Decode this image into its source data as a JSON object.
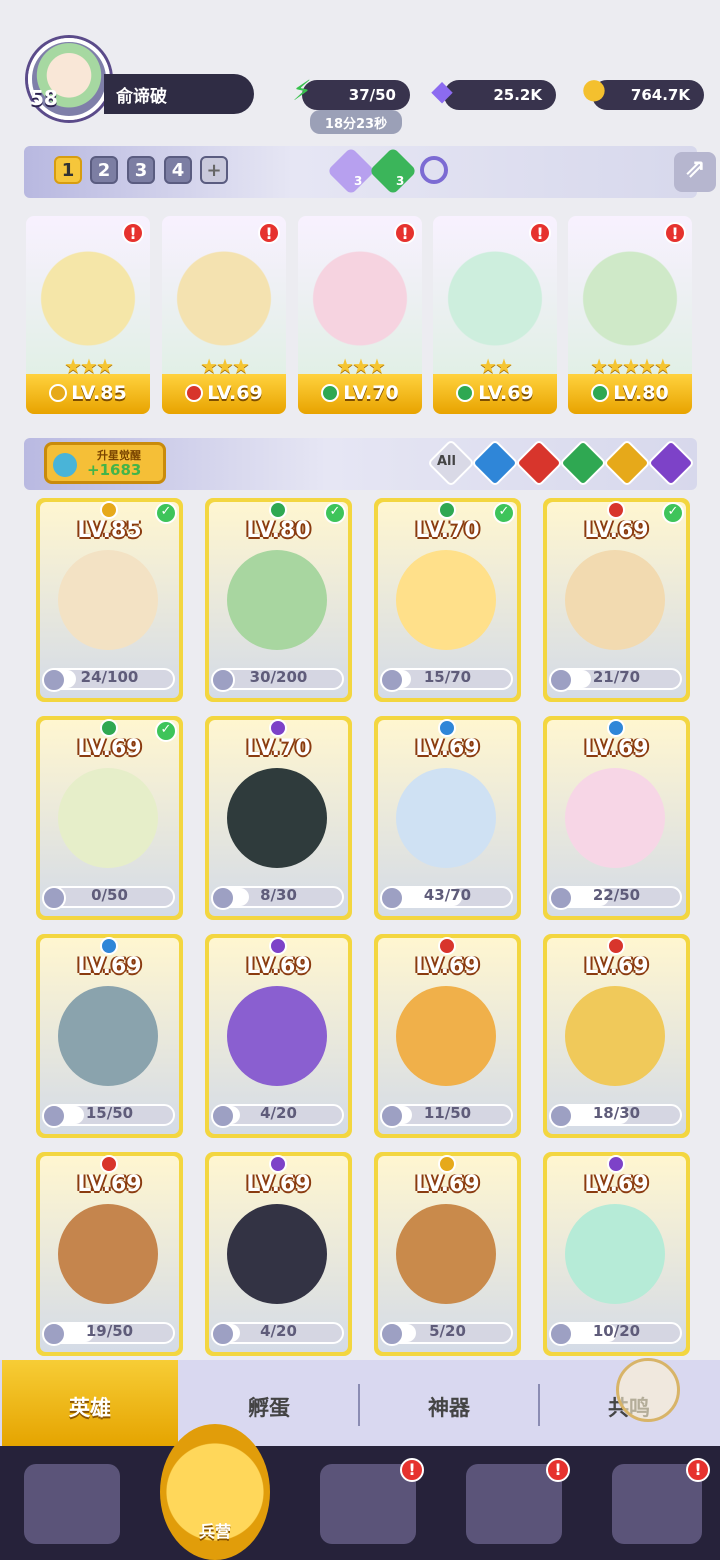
{
  "profile": {
    "level": "58",
    "name": "俞谛破"
  },
  "resources": {
    "energy": {
      "value": "37/50",
      "timer": "18分23秒"
    },
    "diamonds": {
      "value": "25.2K"
    },
    "coins": {
      "value": "764.7K"
    }
  },
  "teams": {
    "slots": [
      "1",
      "2",
      "3",
      "4"
    ],
    "add": "+",
    "gem1": "3",
    "gem2": "3"
  },
  "team_cards": [
    {
      "lv": "LV.85",
      "element": "light",
      "stars": "★★★"
    },
    {
      "lv": "LV.69",
      "element": "fire",
      "stars": "★★★"
    },
    {
      "lv": "LV.70",
      "element": "wind",
      "stars": "★★★"
    },
    {
      "lv": "LV.69",
      "element": "wind",
      "stars": "★★"
    },
    {
      "lv": "LV.80",
      "element": "wind",
      "stars": "★★★★★"
    }
  ],
  "upgrade": {
    "title": "升星觉醒",
    "count": "+1683"
  },
  "filters": {
    "all": "All"
  },
  "heroes": [
    {
      "lv": "LV.85",
      "el": "light",
      "prog": "24/100",
      "check": true
    },
    {
      "lv": "LV.80",
      "el": "wind",
      "prog": "30/200",
      "check": true
    },
    {
      "lv": "LV.70",
      "el": "wind",
      "prog": "15/70",
      "check": true
    },
    {
      "lv": "LV.69",
      "el": "fire",
      "prog": "21/70",
      "check": true
    },
    {
      "lv": "LV.69",
      "el": "wind",
      "prog": "0/50",
      "check": true
    },
    {
      "lv": "LV.70",
      "el": "dark",
      "prog": "8/30",
      "check": false
    },
    {
      "lv": "LV.69",
      "el": "water",
      "prog": "43/70",
      "check": false
    },
    {
      "lv": "LV.69",
      "el": "water",
      "prog": "22/50",
      "check": false
    },
    {
      "lv": "LV.69",
      "el": "water",
      "prog": "15/50",
      "check": false
    },
    {
      "lv": "LV.69",
      "el": "dark",
      "prog": "4/20",
      "check": false
    },
    {
      "lv": "LV.69",
      "el": "fire",
      "prog": "11/50",
      "check": false
    },
    {
      "lv": "LV.69",
      "el": "fire",
      "prog": "18/30",
      "check": false
    },
    {
      "lv": "LV.69",
      "el": "fire",
      "prog": "19/50",
      "check": false
    },
    {
      "lv": "LV.69",
      "el": "dark",
      "prog": "4/20",
      "check": false
    },
    {
      "lv": "LV.69",
      "el": "light",
      "prog": "5/20",
      "check": false
    },
    {
      "lv": "LV.69",
      "el": "dark",
      "prog": "10/20",
      "check": false
    }
  ],
  "tabs": [
    "英雄",
    "孵蛋",
    "神器",
    "共鸣"
  ],
  "nav": {
    "barracks": "兵营"
  },
  "colors": {
    "fire": "#d8352c",
    "water": "#2f86d8",
    "wind": "#2fa852",
    "light": "#e6a91a",
    "dark": "#7d42c8",
    "gold": "#f3d640"
  }
}
